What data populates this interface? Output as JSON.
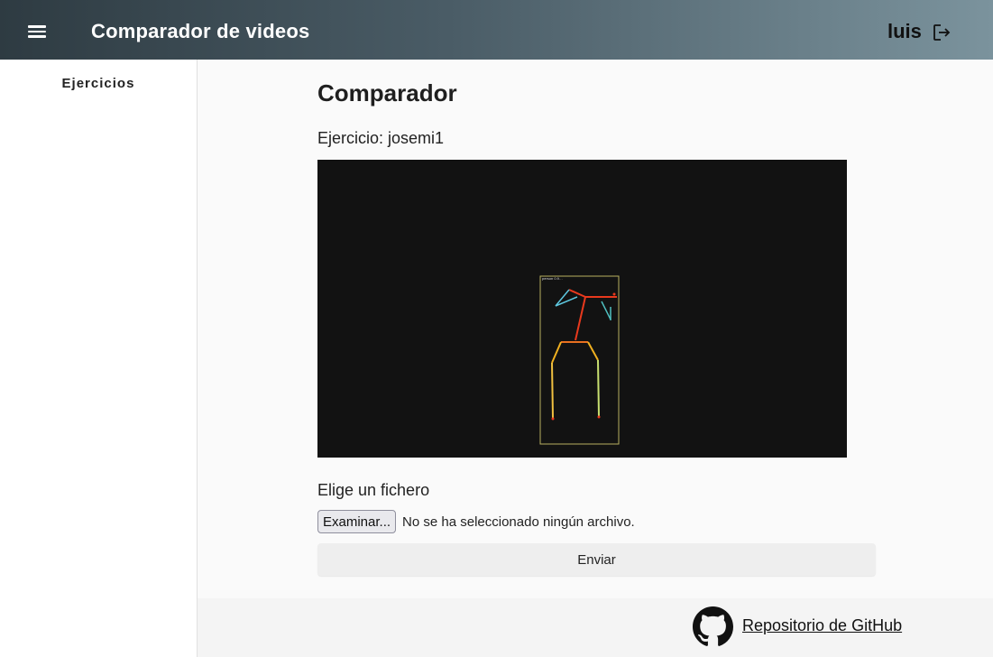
{
  "header": {
    "menu_icon": "hamburger-menu-icon",
    "title": "Comparador de videos",
    "user": "luis",
    "logout_icon": "logout-icon"
  },
  "sidebar": {
    "items": [
      {
        "label": "Ejercicios"
      }
    ]
  },
  "main": {
    "title": "Comparador",
    "exercise_label": "Ejercicio:",
    "exercise_name": "josemi1",
    "video": {
      "box_caption": "person 0.9…"
    },
    "file_label": "Elige un fichero",
    "browse_button": "Examinar...",
    "no_file_text": "No se ha seleccionado ningún archivo.",
    "submit_button": "Enviar"
  },
  "footer": {
    "github_icon": "github-icon",
    "repo_link": "Repositorio de GitHub"
  },
  "colors": {
    "header_gradient_start": "#2e3b42",
    "header_gradient_end": "#7b939d",
    "video_bg": "#121212",
    "pose_torso": "#e8391d",
    "pose_left_arm": "#5ec8e0",
    "pose_legs": "#f0c040",
    "bbox": "#b8b060"
  }
}
